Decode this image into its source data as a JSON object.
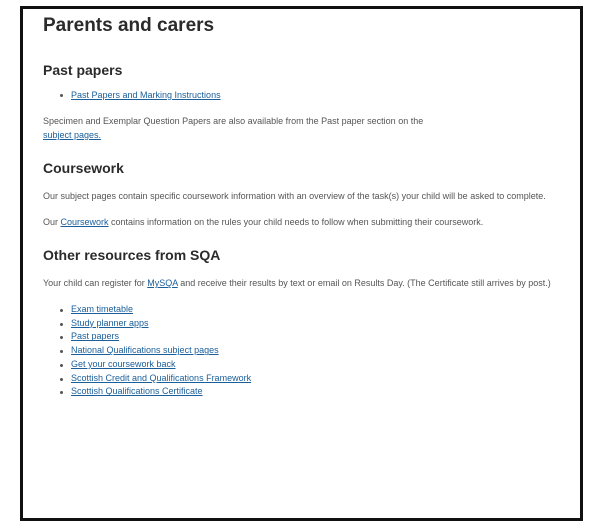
{
  "page": {
    "title": "Parents and carers"
  },
  "past_papers": {
    "heading": "Past papers",
    "link": "Past Papers and Marking Instructions",
    "spec_text": "Specimen and Exemplar Question Papers are also available from the Past paper section on the",
    "spec_link": "subject pages."
  },
  "coursework": {
    "heading": "Coursework",
    "para1": "Our subject pages contain specific coursework information with an overview of the task(s) your child will be asked to complete.",
    "para2_before": "Our ",
    "para2_link": "Coursework",
    "para2_after": " contains information on the rules your child needs to follow when submitting their coursework."
  },
  "other_resources": {
    "heading": "Other resources from SQA",
    "para_before": "Your child can register for ",
    "para_link": "MySQA",
    "para_after": " and receive their results by text or email on Results Day. (The Certificate still arrives by post.)",
    "links": [
      "Exam timetable",
      "Study planner apps",
      "Past papers",
      "National Qualifications subject pages",
      "Get your coursework back",
      "Scottish Credit and Qualifications Framework",
      "Scottish Qualifications Certificate"
    ]
  },
  "colors": {
    "link": "#1a5e9a",
    "heading": "#2b2b2b",
    "body_text": "#555555",
    "frame_border": "#111111"
  }
}
